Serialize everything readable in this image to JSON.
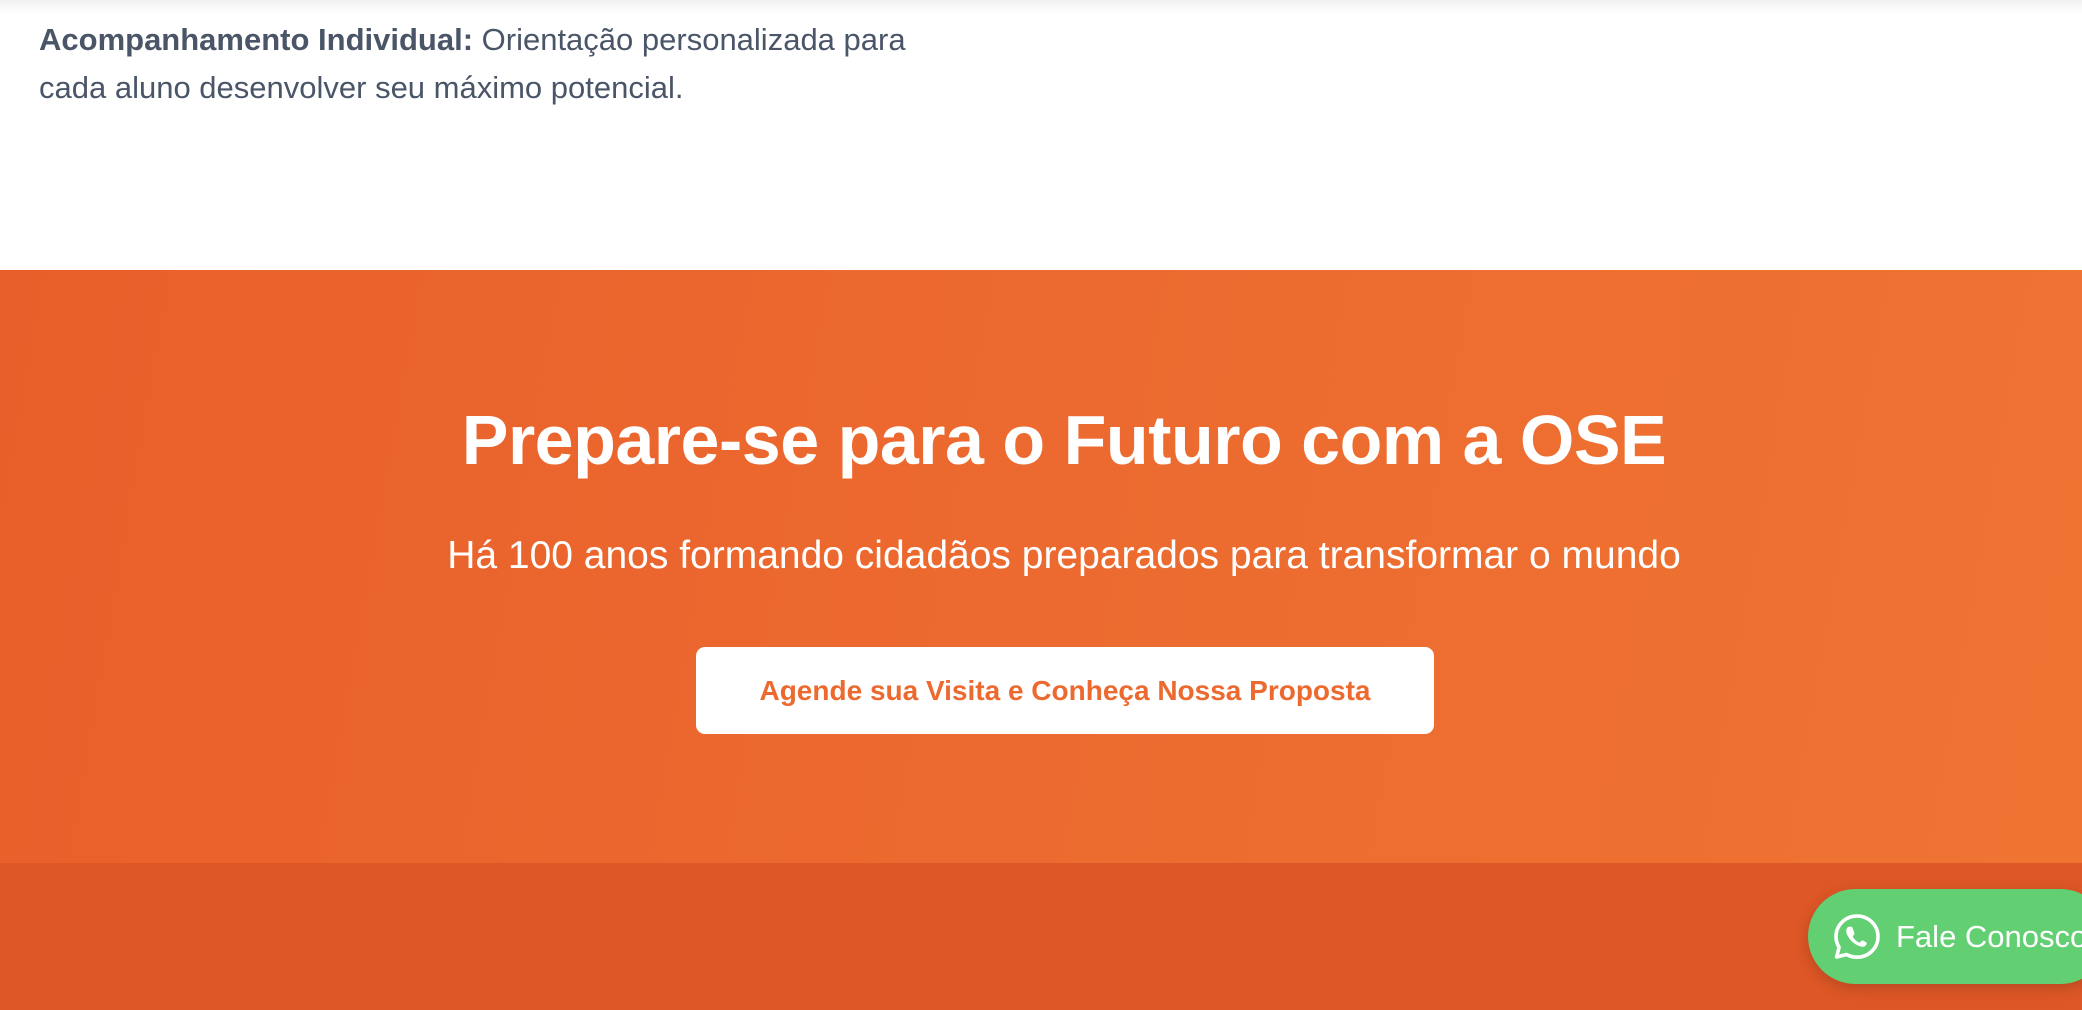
{
  "feature": {
    "title": "Acompanhamento Individual:",
    "description": " Orientação personalizada para cada aluno desenvolver seu máximo potencial."
  },
  "cta": {
    "title": "Prepare-se para o Futuro com a OSE",
    "subtitle": "Há 100 anos formando cidadãos preparados para transformar o mundo",
    "button_label": "Agende sua Visita e Conheça Nossa Proposta"
  },
  "whatsapp": {
    "label": "Fale Conosco",
    "icon": "whatsapp-icon"
  },
  "colors": {
    "accent_orange": "#ec6a2f",
    "footer_orange": "#de5726",
    "whatsapp_green": "#63cf73",
    "text_gray": "#4a5568"
  }
}
